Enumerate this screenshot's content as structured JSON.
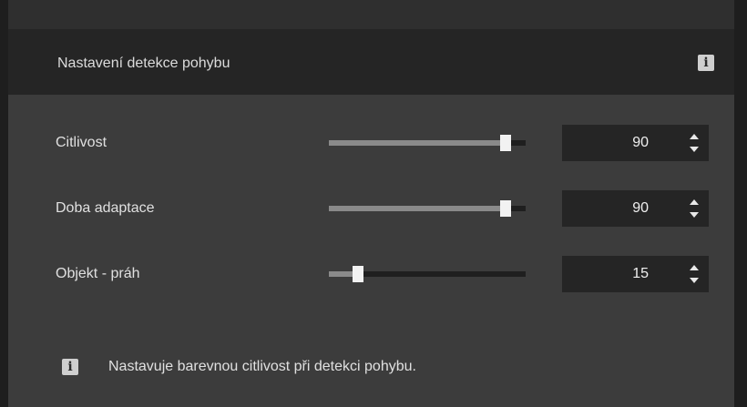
{
  "panel": {
    "title": "Nastavení detekce pohybu",
    "info_icon": "info-icon"
  },
  "settings": [
    {
      "label": "Citlivost",
      "value": "90",
      "slider_fraction": 0.9
    },
    {
      "label": "Doba adaptace",
      "value": "90",
      "slider_fraction": 0.9
    },
    {
      "label": "Objekt - práh",
      "value": "15",
      "slider_fraction": 0.15
    }
  ],
  "hint": {
    "icon": "info-icon",
    "text": "Nastavuje barevnou citlivost při detekci pohybu."
  },
  "colors": {
    "header_bg": "#252525",
    "body_bg": "#3c3c3c",
    "slider_track": "#1f1f1f",
    "slider_fill": "#8a8a8a",
    "slider_thumb": "#f2f2f2"
  }
}
